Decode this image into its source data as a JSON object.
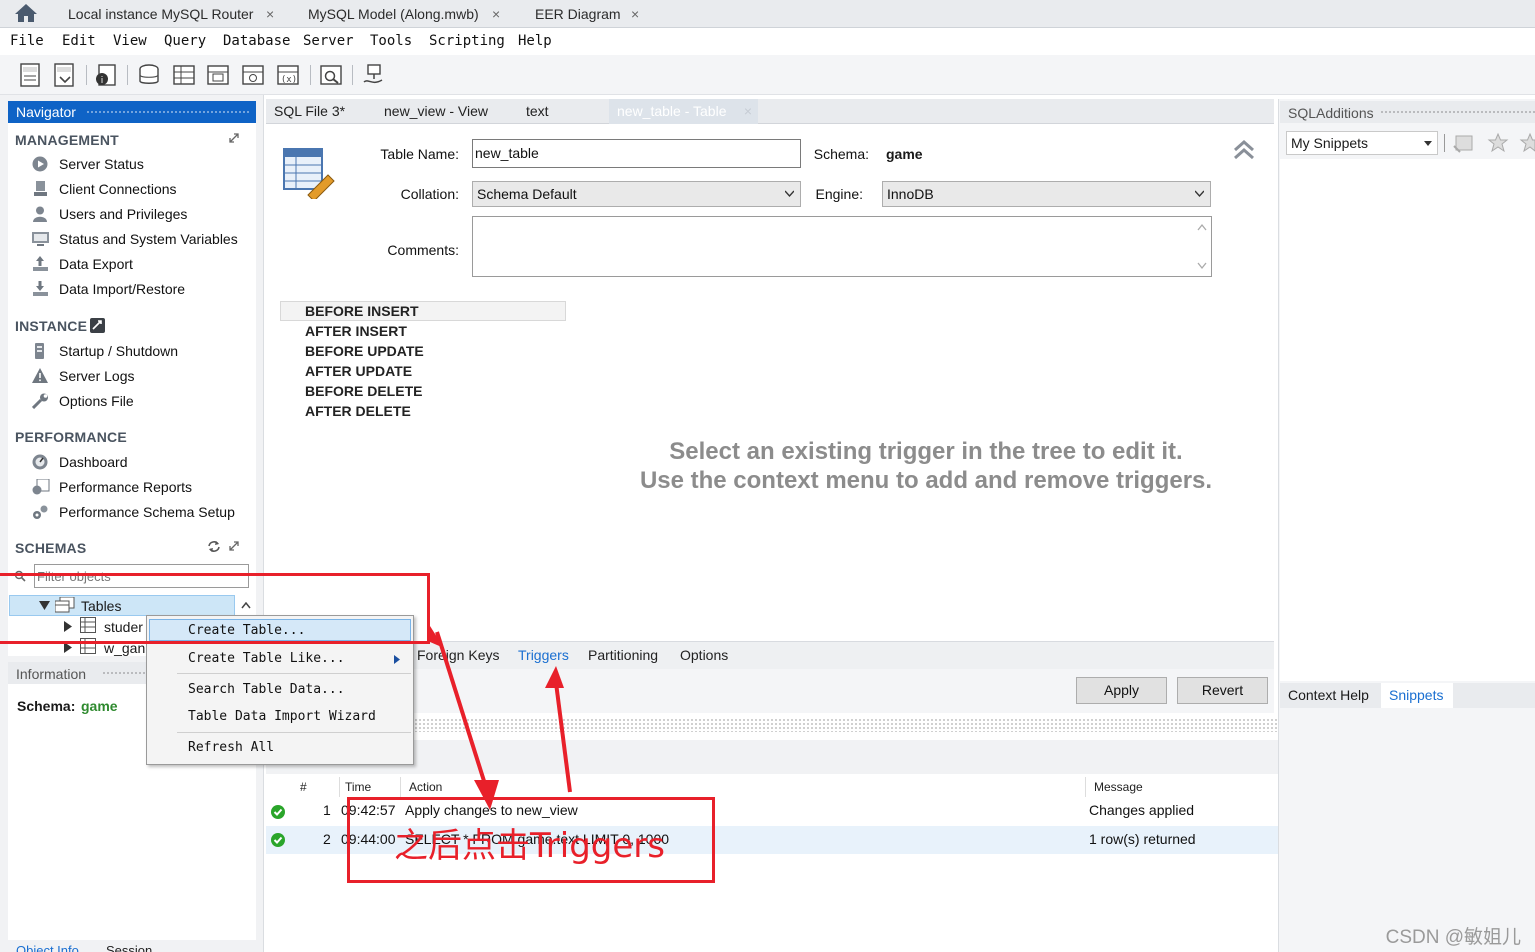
{
  "tabs": {
    "t1": "Local instance MySQL Router",
    "t2": "MySQL Model (Along.mwb)",
    "t3": "EER Diagram",
    "close": "×"
  },
  "menu": [
    "File",
    "Edit",
    "View",
    "Query",
    "Database",
    "Server",
    "Tools",
    "Scripting",
    "Help"
  ],
  "navigator": {
    "title": "Navigator",
    "management": {
      "title": "MANAGEMENT",
      "items": [
        "Server Status",
        "Client Connections",
        "Users and Privileges",
        "Status and System Variables",
        "Data Export",
        "Data Import/Restore"
      ]
    },
    "instance": {
      "title": "INSTANCE",
      "items": [
        "Startup / Shutdown",
        "Server Logs",
        "Options File"
      ]
    },
    "performance": {
      "title": "PERFORMANCE",
      "items": [
        "Dashboard",
        "Performance Reports",
        "Performance Schema Setup"
      ]
    },
    "schemas": {
      "title": "SCHEMAS",
      "filter_placeholder": "Filter objects",
      "tables_label": "Tables",
      "row1": "studer",
      "row2": "w_gan"
    },
    "information": {
      "title": "Information",
      "schema_label": "Schema:",
      "schema_value": "game"
    },
    "bottom_tabs": [
      "Object Info",
      "Session"
    ]
  },
  "editor_tabs": [
    "SQL File 3*",
    "new_view - View",
    "text",
    "new_table - Table"
  ],
  "editor": {
    "table_name_label": "Table Name:",
    "table_name_value": "new_table",
    "schema_label": "Schema:",
    "schema_value": "game",
    "collation_label": "Collation:",
    "collation_value": "Schema Default",
    "engine_label": "Engine:",
    "engine_value": "InnoDB",
    "comments_label": "Comments:",
    "triggers": [
      "BEFORE INSERT",
      "AFTER INSERT",
      "BEFORE UPDATE",
      "AFTER UPDATE",
      "BEFORE DELETE",
      "AFTER DELETE"
    ],
    "hint_line1": "Select an existing trigger in the tree to edit it.",
    "hint_line2": "Use the context menu to add and remove triggers.",
    "subtabs": [
      "Foreign Keys",
      "Triggers",
      "Partitioning",
      "Options"
    ],
    "apply": "Apply",
    "revert": "Revert"
  },
  "output": {
    "columns": [
      "#",
      "Time",
      "Action",
      "Message"
    ],
    "rows": [
      {
        "num": "1",
        "time": "09:42:57",
        "action": "Apply changes to new_view",
        "message": "Changes applied"
      },
      {
        "num": "2",
        "time": "09:44:00",
        "action": "SELECT * FROM game.text LIMIT 0, 1000",
        "message": "1 row(s) returned"
      }
    ]
  },
  "right_panel": {
    "title": "SQLAdditions",
    "snippets_select": "My Snippets",
    "tabs": [
      "Context Help",
      "Snippets"
    ]
  },
  "context_menu": [
    "Create Table...",
    "Create Table Like...",
    "Search Table Data...",
    "Table Data Import Wizard",
    "Refresh All"
  ],
  "annotation": "之后点击Triggers",
  "watermark": "CSDN @敏姐儿",
  "colors": {
    "nav_header": "#0f63c6",
    "accent_link": "#1a6fd1",
    "annotation_red": "#e8202a",
    "ok_green": "#2aa52a"
  }
}
